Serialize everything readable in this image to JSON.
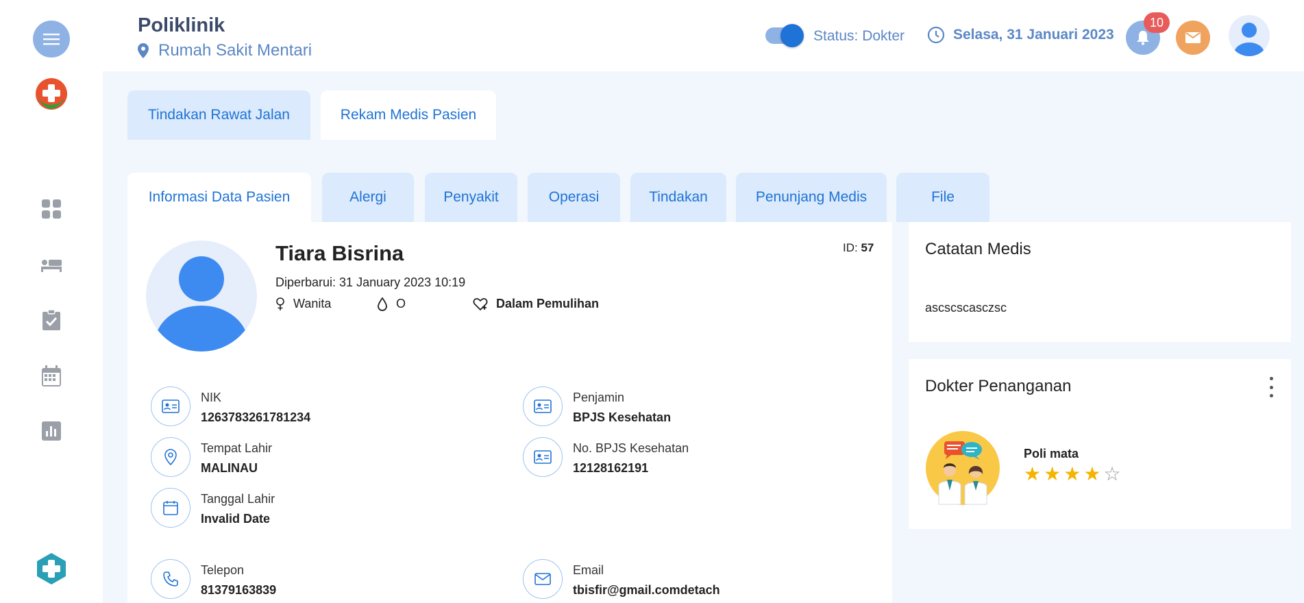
{
  "header": {
    "title": "Poliklinik",
    "location": "Rumah Sakit Mentari",
    "status": "Status: Dokter",
    "date": "Selasa, 31 Januari 2023",
    "notification_count": "10"
  },
  "main_tabs": [
    {
      "label": "Tindakan Rawat Jalan"
    },
    {
      "label": "Rekam Medis Pasien"
    }
  ],
  "sub_tabs": [
    {
      "label": "Informasi Data Pasien"
    },
    {
      "label": "Alergi"
    },
    {
      "label": "Penyakit"
    },
    {
      "label": "Operasi"
    },
    {
      "label": "Tindakan"
    },
    {
      "label": "Penunjang Medis"
    },
    {
      "label": "File"
    }
  ],
  "patient": {
    "name": "Tiara Bisrina",
    "updated": "Diperbarui: 31 January 2023 10:19",
    "id_label": "ID:",
    "id_value": "57",
    "gender": "Wanita",
    "blood_type": "O",
    "condition": "Dalam Pemulihan",
    "fields": [
      {
        "label": "NIK",
        "value": "1263783261781234"
      },
      {
        "label": "Penjamin",
        "value": "BPJS Kesehatan"
      },
      {
        "label": "Tempat Lahir",
        "value": "MALINAU"
      },
      {
        "label": "No. BPJS Kesehatan",
        "value": "12128162191"
      },
      {
        "label": "Tanggal Lahir",
        "value": "Invalid Date"
      },
      {
        "label": "Telepon",
        "value": "81379163839"
      },
      {
        "label": "Email",
        "value": "tbisfir@gmail.comdetach"
      }
    ]
  },
  "notes": {
    "title": "Catatan Medis",
    "text": "ascscscasczsc"
  },
  "doctor": {
    "title": "Dokter Penanganan",
    "poli": "Poli mata",
    "rating": 4,
    "rating_max": 5,
    "stars": [
      "★",
      "★",
      "★",
      "★",
      "☆"
    ]
  },
  "colors": {
    "accent": "#1f73d6",
    "accent_soft": "#dbeafc",
    "page_bg": "#f2f6fd",
    "muted_blue": "#5b87c5",
    "badge": "#e85b5b",
    "mail": "#f0a35e",
    "star": "#f5b400"
  },
  "icons": {
    "sidebar": [
      "menu-icon",
      "hospital-logo-icon",
      "dashboard-icon",
      "bed-icon",
      "clipboard-check-icon",
      "calendar-icon",
      "chart-icon",
      "medical-cross-icon"
    ],
    "header": [
      "location-pin-icon",
      "clock-icon",
      "bell-icon",
      "mail-icon",
      "user-avatar-icon"
    ]
  }
}
